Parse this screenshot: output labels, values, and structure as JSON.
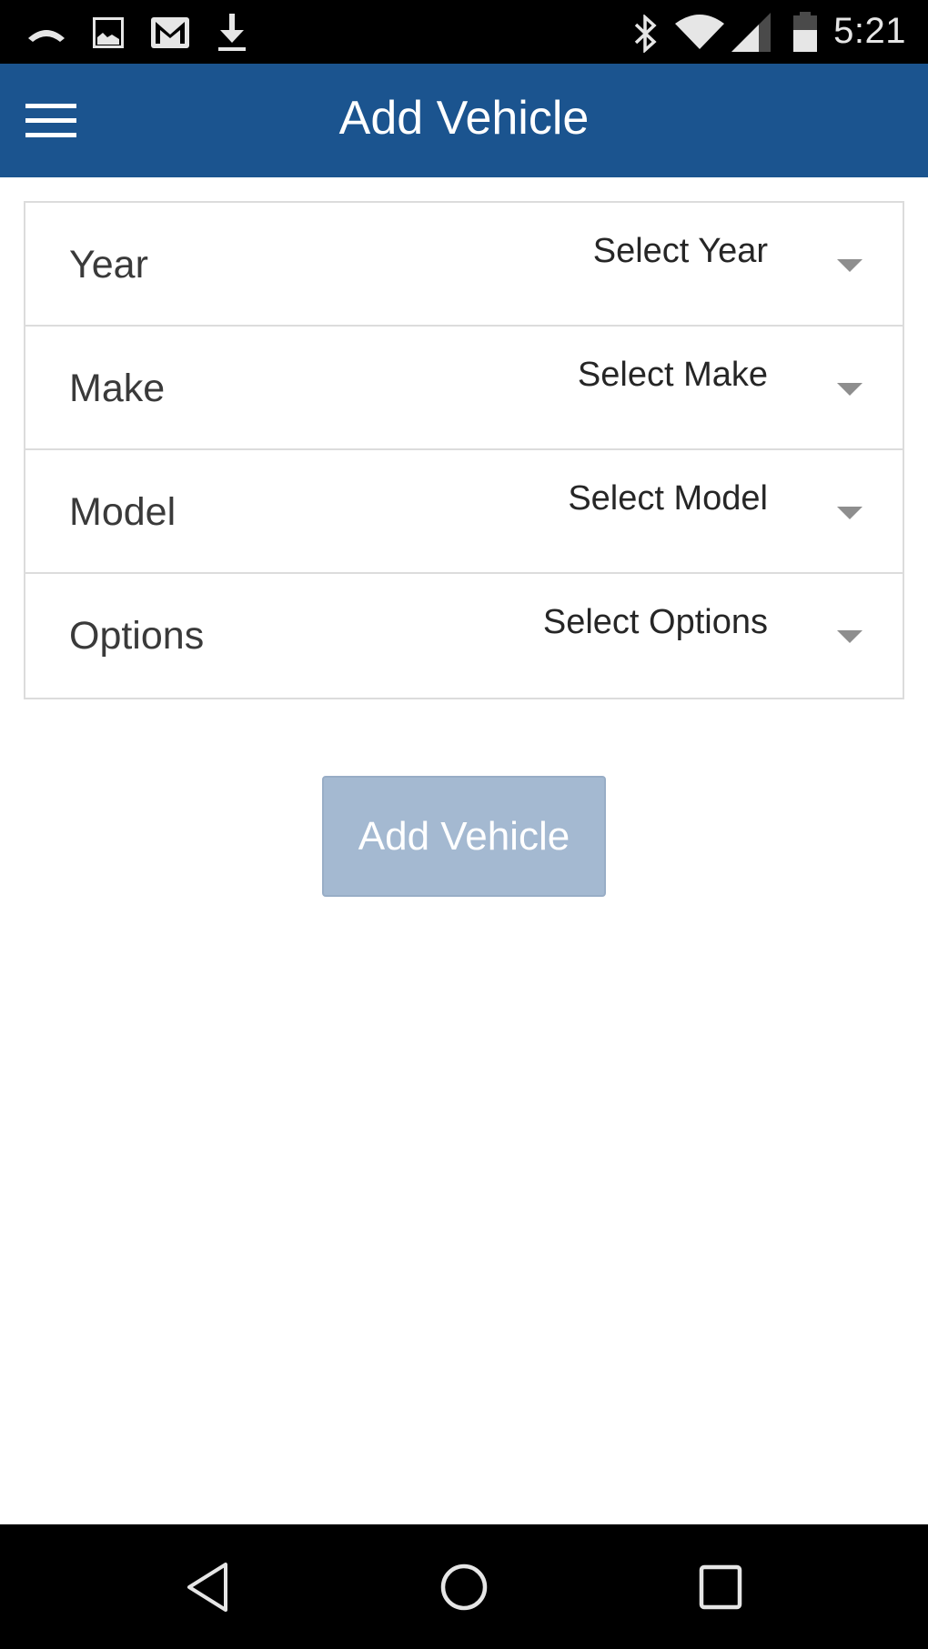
{
  "status_bar": {
    "left_icons": [
      "missed-call-icon",
      "image-icon",
      "gmail-icon",
      "download-icon"
    ],
    "right_icons": [
      "bluetooth-icon",
      "wifi-icon",
      "cell-signal-icon",
      "battery-icon"
    ],
    "time": "5:21"
  },
  "app_bar": {
    "menu_icon": "hamburger-menu-icon",
    "title": "Add Vehicle",
    "color": "#1b548f"
  },
  "form": {
    "rows": [
      {
        "label": "Year",
        "value": "Select Year"
      },
      {
        "label": "Make",
        "value": "Select Make"
      },
      {
        "label": "Model",
        "value": "Select Model"
      },
      {
        "label": "Options",
        "value": "Select Options"
      }
    ]
  },
  "submit": {
    "label": "Add Vehicle",
    "state": "disabled",
    "color": "#a4b9d1"
  },
  "nav_bar": {
    "icons": [
      "back-icon",
      "home-icon",
      "recents-icon"
    ]
  }
}
